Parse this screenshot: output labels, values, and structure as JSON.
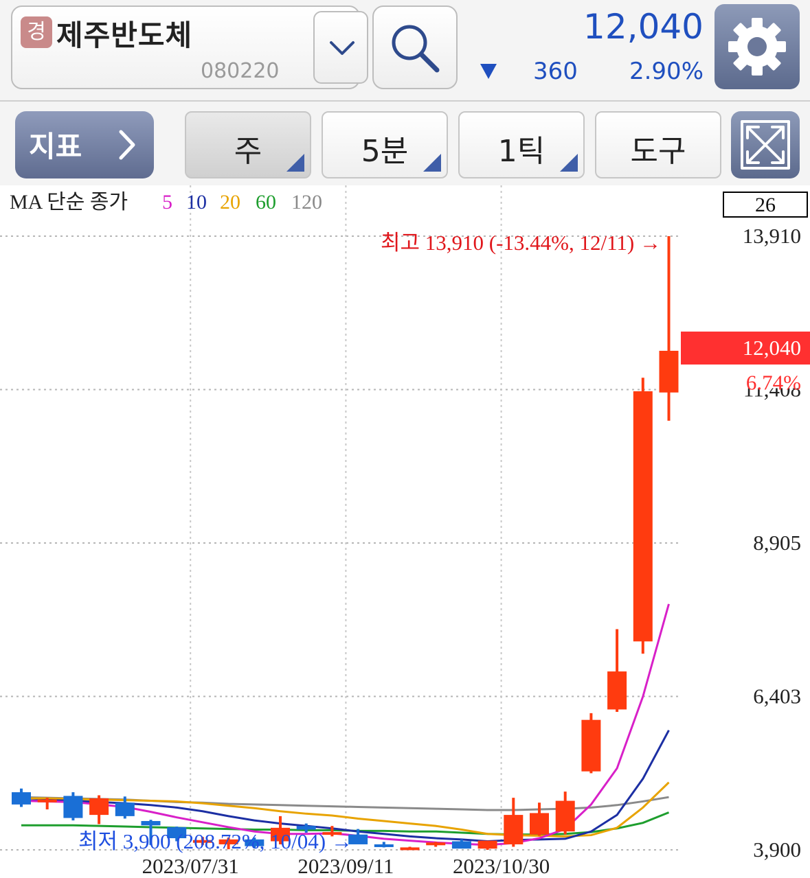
{
  "header": {
    "market_badge": "경",
    "stock_name": "제주반도체",
    "stock_code": "080220",
    "price": "12,040",
    "change_value": "360",
    "change_percent": "2.90%",
    "direction": "down",
    "colors": {
      "down": "#1f4fbf",
      "up": "#ff3b0f"
    }
  },
  "toolbar": {
    "indicator_label": "지표",
    "period_label": "주",
    "interval_label": "5분",
    "tick_label": "1틱",
    "tools_label": "도구"
  },
  "icons": {
    "dropdown": "chevron-down-icon",
    "search": "search-icon",
    "settings": "gear-icon",
    "indicator": "chevron-right-icon",
    "expand": "expand-icon"
  },
  "chart_data": {
    "type": "candlestick",
    "legend": {
      "prefix": "MA 단순 종가",
      "periods": [
        {
          "label": "5",
          "color": "#d820c8"
        },
        {
          "label": "10",
          "color": "#1c2fa3"
        },
        {
          "label": "20",
          "color": "#e8a300"
        },
        {
          "label": "60",
          "color": "#1e9e2e"
        },
        {
          "label": "120",
          "color": "#8a8a8a"
        }
      ]
    },
    "visible_count": "26",
    "y_ticks": [
      "13,910",
      "8,905",
      "6,403",
      "3,900"
    ],
    "y_tick_values": [
      13910,
      8905,
      6403,
      3900
    ],
    "partial_tick": "11,408",
    "x_labels": [
      "2023/07/31",
      "2023/09/11",
      "2023/10/30"
    ],
    "x_label_indices": [
      6,
      12,
      18
    ],
    "current_price_label": "12,040",
    "current_pct_label": "6.74%",
    "current_price": 12040,
    "high_annotation": "최고 13,910 (-13.44%, 12/11) →",
    "low_annotation": "최저 3,900 (208.72%, 10/04) →",
    "up_color": "#ff3b0f",
    "down_color": "#1a6fd6",
    "candles": [
      {
        "o": 4840,
        "h": 4900,
        "l": 4600,
        "c": 4640
      },
      {
        "o": 4690,
        "h": 4750,
        "l": 4560,
        "c": 4720
      },
      {
        "o": 4780,
        "h": 4840,
        "l": 4380,
        "c": 4420
      },
      {
        "o": 4470,
        "h": 4790,
        "l": 4320,
        "c": 4740
      },
      {
        "o": 4670,
        "h": 4770,
        "l": 4410,
        "c": 4450
      },
      {
        "o": 4370,
        "h": 4390,
        "l": 3980,
        "c": 4300
      },
      {
        "o": 4270,
        "h": 4280,
        "l": 4040,
        "c": 4090
      },
      {
        "o": 4040,
        "h": 4110,
        "l": 3980,
        "c": 4060
      },
      {
        "o": 3990,
        "h": 4100,
        "l": 3910,
        "c": 4070
      },
      {
        "o": 4070,
        "h": 4100,
        "l": 3930,
        "c": 3960
      },
      {
        "o": 4040,
        "h": 4450,
        "l": 3990,
        "c": 4260
      },
      {
        "o": 4290,
        "h": 4330,
        "l": 4180,
        "c": 4230
      },
      {
        "o": 4180,
        "h": 4290,
        "l": 4120,
        "c": 4190
      },
      {
        "o": 4150,
        "h": 4240,
        "l": 4010,
        "c": 3990
      },
      {
        "o": 3990,
        "h": 4030,
        "l": 3940,
        "c": 3950
      },
      {
        "o": 3930,
        "h": 3950,
        "l": 3900,
        "c": 3940
      },
      {
        "o": 3980,
        "h": 4030,
        "l": 3950,
        "c": 4020
      },
      {
        "o": 4040,
        "h": 4070,
        "l": 3950,
        "c": 3920
      },
      {
        "o": 3920,
        "h": 4020,
        "l": 3900,
        "c": 4050
      },
      {
        "o": 3990,
        "h": 4750,
        "l": 3950,
        "c": 4470
      },
      {
        "o": 4150,
        "h": 4670,
        "l": 4130,
        "c": 4500
      },
      {
        "o": 4200,
        "h": 4850,
        "l": 4150,
        "c": 4700
      },
      {
        "o": 5180,
        "h": 6130,
        "l": 5150,
        "c": 6020
      },
      {
        "o": 6190,
        "h": 7500,
        "l": 6150,
        "c": 6810
      },
      {
        "o": 7300,
        "h": 11600,
        "l": 7100,
        "c": 11380
      },
      {
        "o": 11360,
        "h": 13910,
        "l": 10900,
        "c": 12040
      }
    ],
    "ma": {
      "5": [
        4700,
        4690,
        4680,
        4640,
        4600,
        4520,
        4430,
        4350,
        4270,
        4200,
        4160,
        4160,
        4170,
        4130,
        4080,
        4050,
        4020,
        4000,
        3980,
        4010,
        4090,
        4240,
        4640,
        5230,
        6400,
        7910
      ],
      "10": [
        4700,
        4710,
        4700,
        4680,
        4660,
        4630,
        4590,
        4530,
        4450,
        4380,
        4330,
        4290,
        4250,
        4200,
        4160,
        4120,
        4090,
        4070,
        4040,
        4060,
        4070,
        4080,
        4200,
        4470,
        5060,
        5850
      ],
      "20": [
        4740,
        4740,
        4730,
        4720,
        4710,
        4700,
        4690,
        4660,
        4620,
        4580,
        4530,
        4490,
        4460,
        4410,
        4370,
        4330,
        4290,
        4230,
        4160,
        4140,
        4130,
        4120,
        4140,
        4260,
        4590,
        5000
      ],
      "60": [
        4300,
        4300,
        4300,
        4290,
        4280,
        4270,
        4260,
        4250,
        4240,
        4230,
        4230,
        4220,
        4220,
        4210,
        4210,
        4200,
        4200,
        4180,
        4160,
        4150,
        4150,
        4160,
        4190,
        4250,
        4340,
        4510
      ],
      "120": [
        4760,
        4750,
        4740,
        4730,
        4720,
        4700,
        4680,
        4670,
        4650,
        4640,
        4630,
        4620,
        4610,
        4600,
        4590,
        4580,
        4570,
        4560,
        4550,
        4550,
        4560,
        4570,
        4590,
        4630,
        4690,
        4760
      ]
    }
  }
}
